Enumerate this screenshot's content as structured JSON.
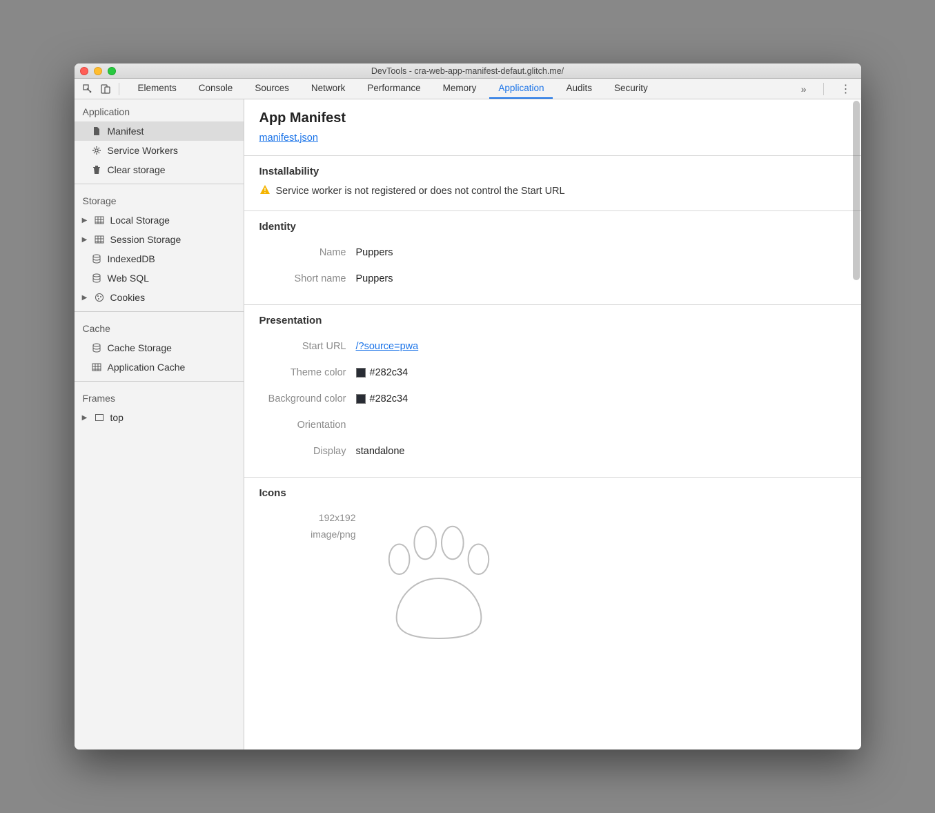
{
  "window": {
    "title": "DevTools - cra-web-app-manifest-defaut.glitch.me/"
  },
  "tabs": {
    "items": [
      "Elements",
      "Console",
      "Sources",
      "Network",
      "Performance",
      "Memory",
      "Application",
      "Audits",
      "Security"
    ],
    "active": "Application"
  },
  "sidebar": {
    "groups": [
      {
        "title": "Application",
        "items": [
          {
            "label": "Manifest",
            "icon": "file-icon",
            "selected": true
          },
          {
            "label": "Service Workers",
            "icon": "gear-icon"
          },
          {
            "label": "Clear storage",
            "icon": "trash-icon"
          }
        ]
      },
      {
        "title": "Storage",
        "items": [
          {
            "label": "Local Storage",
            "icon": "grid-icon",
            "expandable": true
          },
          {
            "label": "Session Storage",
            "icon": "grid-icon",
            "expandable": true
          },
          {
            "label": "IndexedDB",
            "icon": "db-icon"
          },
          {
            "label": "Web SQL",
            "icon": "db-icon"
          },
          {
            "label": "Cookies",
            "icon": "cookie-icon",
            "expandable": true
          }
        ]
      },
      {
        "title": "Cache",
        "items": [
          {
            "label": "Cache Storage",
            "icon": "db-icon"
          },
          {
            "label": "Application Cache",
            "icon": "grid-icon"
          }
        ]
      },
      {
        "title": "Frames",
        "items": [
          {
            "label": "top",
            "icon": "frame-icon",
            "expandable": true
          }
        ]
      }
    ]
  },
  "manifest": {
    "panel_title": "App Manifest",
    "link_text": "manifest.json",
    "installability": {
      "title": "Installability",
      "warning": "Service worker is not registered or does not control the Start URL"
    },
    "identity": {
      "title": "Identity",
      "name_label": "Name",
      "name_value": "Puppers",
      "short_name_label": "Short name",
      "short_name_value": "Puppers"
    },
    "presentation": {
      "title": "Presentation",
      "start_url_label": "Start URL",
      "start_url_value": "/?source=pwa",
      "theme_color_label": "Theme color",
      "theme_color_value": "#282c34",
      "background_color_label": "Background color",
      "background_color_value": "#282c34",
      "orientation_label": "Orientation",
      "orientation_value": "",
      "display_label": "Display",
      "display_value": "standalone"
    },
    "icons": {
      "title": "Icons",
      "size": "192x192",
      "mime": "image/png"
    }
  }
}
